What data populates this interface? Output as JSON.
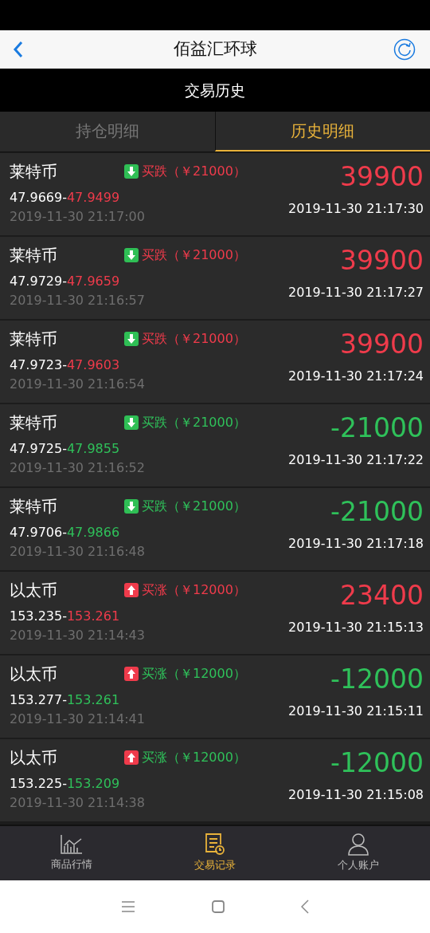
{
  "header": {
    "title": "佰益汇环球"
  },
  "subheader": {
    "title": "交易历史"
  },
  "tabs": [
    {
      "label": "持仓明细",
      "selected": false
    },
    {
      "label": "历史明细",
      "selected": true
    }
  ],
  "trades": [
    {
      "name": "莱特币",
      "rising": false,
      "profit": true,
      "order": "买跌（￥21000）",
      "open_price": "47.9669-",
      "close_price": "47.9499",
      "open_time": "2019-11-30 21:17:00",
      "result": "39900",
      "close_time": "2019-11-30 21:17:30"
    },
    {
      "name": "莱特币",
      "rising": false,
      "profit": true,
      "order": "买跌（￥21000）",
      "open_price": "47.9729-",
      "close_price": "47.9659",
      "open_time": "2019-11-30 21:16:57",
      "result": "39900",
      "close_time": "2019-11-30 21:17:27"
    },
    {
      "name": "莱特币",
      "rising": false,
      "profit": true,
      "order": "买跌（￥21000）",
      "open_price": "47.9723-",
      "close_price": "47.9603",
      "open_time": "2019-11-30 21:16:54",
      "result": "39900",
      "close_time": "2019-11-30 21:17:24"
    },
    {
      "name": "莱特币",
      "rising": false,
      "profit": false,
      "order": "买跌（￥21000）",
      "open_price": "47.9725-",
      "close_price": "47.9855",
      "open_time": "2019-11-30 21:16:52",
      "result": "-21000",
      "close_time": "2019-11-30 21:17:22"
    },
    {
      "name": "莱特币",
      "rising": false,
      "profit": false,
      "order": "买跌（￥21000）",
      "open_price": "47.9706-",
      "close_price": "47.9866",
      "open_time": "2019-11-30 21:16:48",
      "result": "-21000",
      "close_time": "2019-11-30 21:17:18"
    },
    {
      "name": "以太币",
      "rising": true,
      "profit": true,
      "order": "买涨（￥12000）",
      "open_price": "153.235-",
      "close_price": "153.261",
      "open_time": "2019-11-30 21:14:43",
      "result": "23400",
      "close_time": "2019-11-30 21:15:13"
    },
    {
      "name": "以太币",
      "rising": true,
      "profit": false,
      "order": "买涨（￥12000）",
      "open_price": "153.277-",
      "close_price": "153.261",
      "open_time": "2019-11-30 21:14:41",
      "result": "-12000",
      "close_time": "2019-11-30 21:15:11"
    },
    {
      "name": "以太币",
      "rising": true,
      "profit": false,
      "order": "买涨（￥12000）",
      "open_price": "153.225-",
      "close_price": "153.209",
      "open_time": "2019-11-30 21:14:38",
      "result": "-12000",
      "close_time": "2019-11-30 21:15:08"
    }
  ],
  "bottom_nav": [
    {
      "label": "商品行情",
      "kind": "chart",
      "selected": false
    },
    {
      "label": "交易记录",
      "kind": "record",
      "selected": true
    },
    {
      "label": "个人账户",
      "kind": "user",
      "selected": false
    }
  ]
}
